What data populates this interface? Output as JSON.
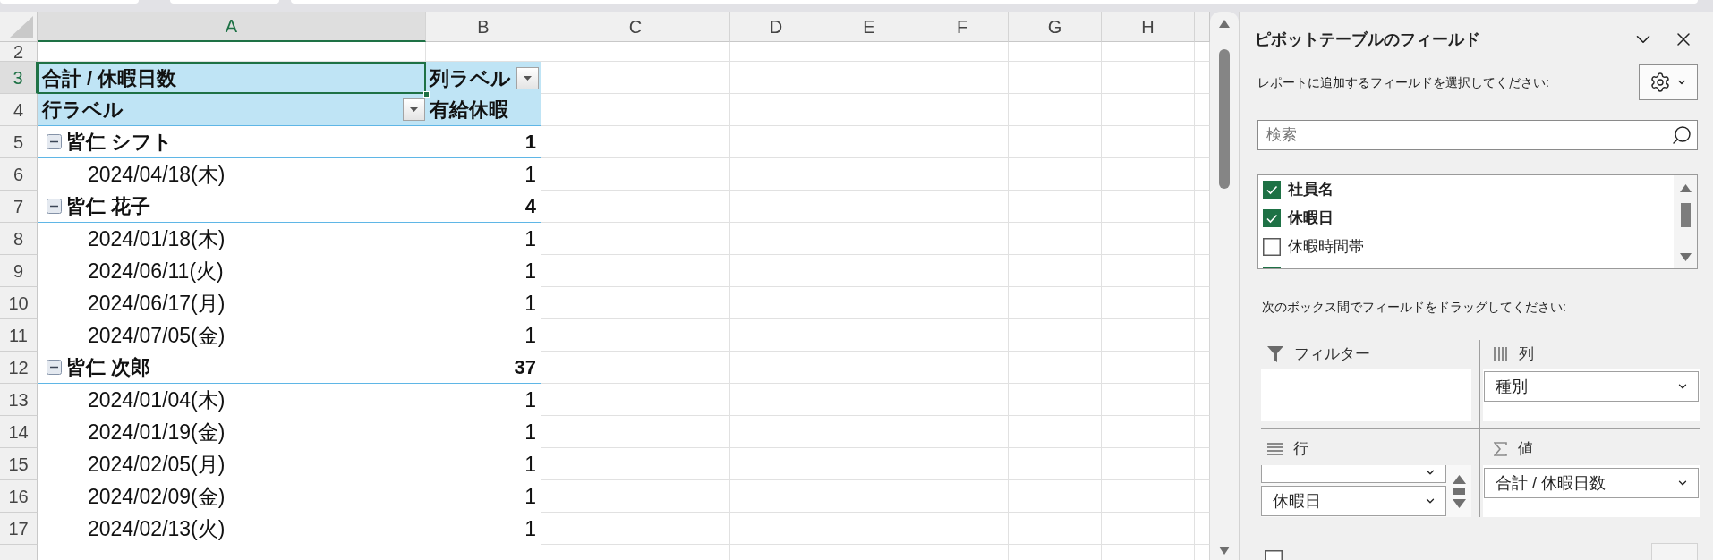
{
  "sheet": {
    "columns": [
      {
        "label": "A",
        "selected": true
      },
      {
        "label": "B",
        "selected": false
      },
      {
        "label": "C",
        "selected": false
      },
      {
        "label": "D",
        "selected": false
      },
      {
        "label": "E",
        "selected": false
      },
      {
        "label": "F",
        "selected": false
      },
      {
        "label": "G",
        "selected": false
      },
      {
        "label": "H",
        "selected": false
      }
    ],
    "rows": [
      {
        "number": "2",
        "selected": false,
        "kind": "blank"
      },
      {
        "number": "3",
        "selected": true,
        "kind": "pivot_title",
        "label": "合計 / 休暇日数",
        "value": "列ラベル"
      },
      {
        "number": "4",
        "selected": false,
        "kind": "pivot_header",
        "label": "行ラベル",
        "value": "有給休暇"
      },
      {
        "number": "5",
        "selected": false,
        "kind": "group",
        "expanded": true,
        "label": "皆仁 シフト",
        "value": "1"
      },
      {
        "number": "6",
        "selected": false,
        "kind": "item",
        "label": "2024/04/18(木)",
        "value": "1"
      },
      {
        "number": "7",
        "selected": false,
        "kind": "group",
        "expanded": true,
        "label": "皆仁 花子",
        "value": "4"
      },
      {
        "number": "8",
        "selected": false,
        "kind": "item",
        "label": "2024/01/18(木)",
        "value": "1"
      },
      {
        "number": "9",
        "selected": false,
        "kind": "item",
        "label": "2024/06/11(火)",
        "value": "1"
      },
      {
        "number": "10",
        "selected": false,
        "kind": "item",
        "label": "2024/06/17(月)",
        "value": "1"
      },
      {
        "number": "11",
        "selected": false,
        "kind": "item",
        "label": "2024/07/05(金)",
        "value": "1"
      },
      {
        "number": "12",
        "selected": false,
        "kind": "group",
        "expanded": true,
        "label": "皆仁 次郎",
        "value": "37"
      },
      {
        "number": "13",
        "selected": false,
        "kind": "item",
        "label": "2024/01/04(木)",
        "value": "1"
      },
      {
        "number": "14",
        "selected": false,
        "kind": "item",
        "label": "2024/01/19(金)",
        "value": "1"
      },
      {
        "number": "15",
        "selected": false,
        "kind": "item",
        "label": "2024/02/05(月)",
        "value": "1"
      },
      {
        "number": "16",
        "selected": false,
        "kind": "item",
        "label": "2024/02/09(金)",
        "value": "1"
      },
      {
        "number": "17",
        "selected": false,
        "kind": "item",
        "label": "2024/02/13(火)",
        "value": "1"
      },
      {
        "selected": false,
        "kind": "item"
      }
    ]
  },
  "pivot_panel": {
    "title": "ピボットテーブルのフィールド",
    "instruction": "レポートに追加するフィールドを選択してください:",
    "search": {
      "placeholder": "検索"
    },
    "fields": [
      {
        "label": "社員名",
        "checked": true
      },
      {
        "label": "休暇日",
        "checked": true
      },
      {
        "label": "休暇時間帯",
        "checked": false
      },
      {
        "checked": true
      }
    ],
    "drag_instruction": "次のボックス間でフィールドをドラッグしてください:",
    "filters": {
      "label": "フィルター"
    },
    "columns": {
      "label": "列",
      "items": [
        "種別"
      ]
    },
    "rows": {
      "label": "行",
      "scrolled": true,
      "items": [
        "休暇日"
      ]
    },
    "values": {
      "label": "値",
      "items": [
        "合計 / 休暇日数"
      ]
    },
    "defer_update": {
      "checked": false
    },
    "update_button": {
      "disabled": true
    }
  }
}
